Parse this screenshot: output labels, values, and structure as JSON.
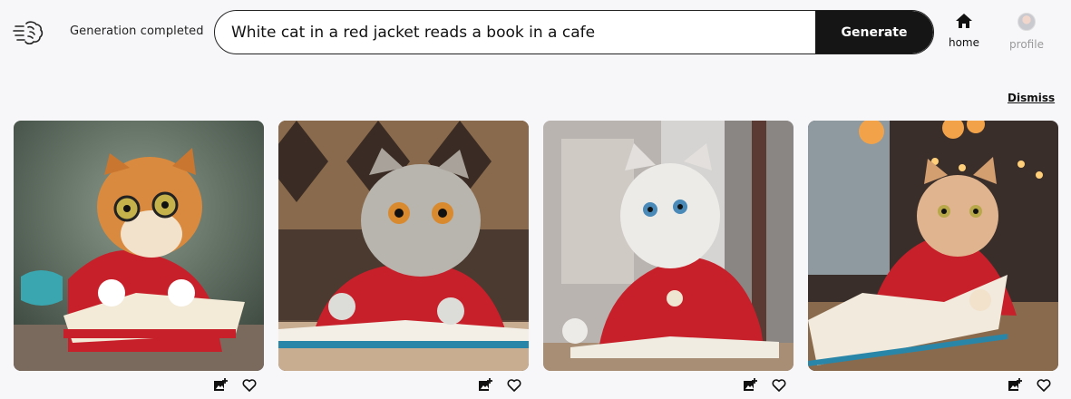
{
  "header": {
    "status": "Generation completed",
    "search": {
      "value": "White cat in a red jacket reads a book in a cafe",
      "placeholder": ""
    },
    "generate_label": "Generate",
    "nav": [
      {
        "label": "home",
        "icon": "home-icon"
      },
      {
        "label": "profile",
        "icon": "avatar"
      }
    ]
  },
  "results": {
    "dismiss_label": "Dismiss",
    "images": [
      {
        "description": "orange tabby cat with glasses in red jacket reading a book next to a teacup",
        "actions": [
          "add-image-icon",
          "heart-icon"
        ]
      },
      {
        "description": "silver tabby cat in red jacket with open book, diamond wallpaper",
        "actions": [
          "add-image-icon",
          "heart-icon"
        ]
      },
      {
        "description": "white cat in red coat with medallion reading book by cafe window",
        "actions": [
          "add-image-icon",
          "heart-icon"
        ]
      },
      {
        "description": "ginger and white cat in red hoodie reading book in a cafe with warm lights",
        "actions": [
          "add-image-icon",
          "heart-icon"
        ]
      }
    ]
  },
  "colors": {
    "accent": "#151515",
    "background": "#f7f7fa",
    "jacket": "#c8202a"
  }
}
